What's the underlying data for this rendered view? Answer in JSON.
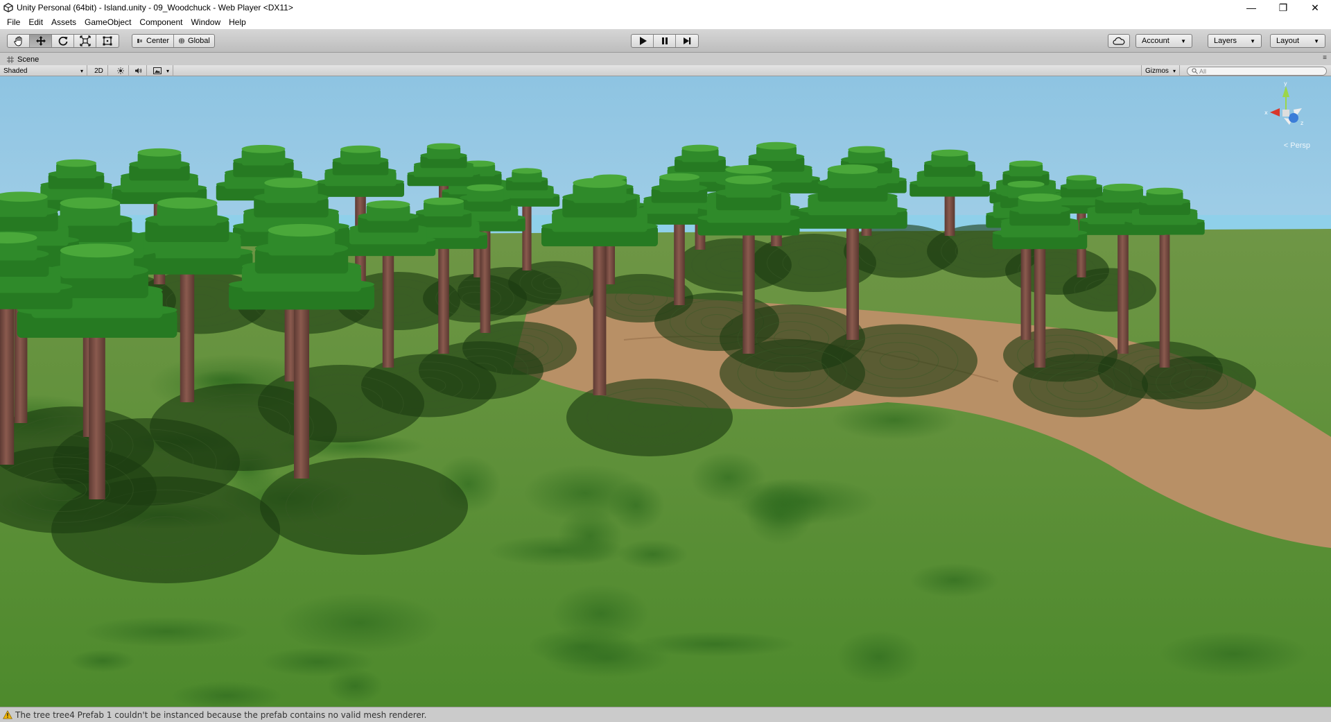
{
  "window": {
    "title": "Unity Personal (64bit) - Island.unity - 09_Woodchuck - Web Player <DX11>",
    "minimize": "—",
    "maximize": "❐",
    "close": "✕"
  },
  "menu": [
    "File",
    "Edit",
    "Assets",
    "GameObject",
    "Component",
    "Window",
    "Help"
  ],
  "toolbar": {
    "transform_tools": [
      "hand-icon",
      "move-icon",
      "rotate-icon",
      "scale-icon",
      "rect-icon"
    ],
    "active_tool": "move-icon",
    "pivot_mode": "Center",
    "pivot_rotation": "Global",
    "account": "Account",
    "layers": "Layers",
    "layout": "Layout"
  },
  "scene_panel": {
    "tab_label": "Scene",
    "draw_mode": "Shaded",
    "mode_2d": "2D",
    "gizmos": "Gizmos",
    "search_placeholder": "All",
    "projection": "< Persp"
  },
  "gizmo_axes": {
    "x": "x",
    "y": "y",
    "z": "z"
  },
  "status": {
    "message": "The tree tree4 Prefab 1 couldn't be instanced because the prefab contains no valid mesh renderer."
  },
  "colors": {
    "sky_top": "#8ec4e2",
    "sky_horizon": "#cfe7f3",
    "grass": "#5a8a2e",
    "dirt": "#b89066",
    "foliage": "#2f8a2a",
    "trunk": "#7a4e44"
  }
}
